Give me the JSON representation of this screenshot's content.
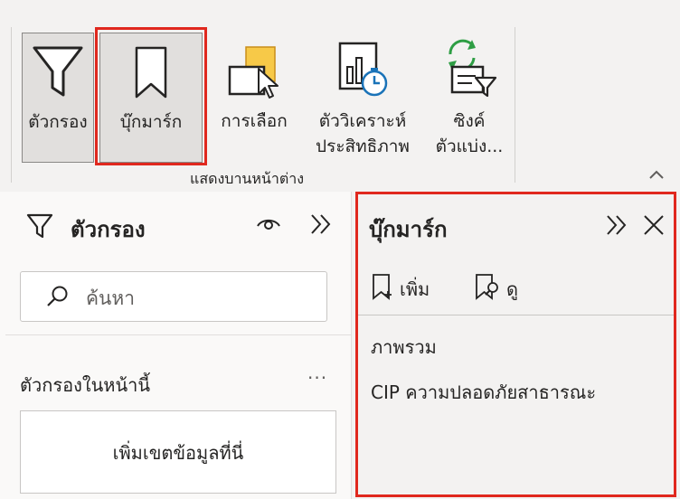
{
  "ribbon": {
    "buttons": {
      "filter": "ตัวกรอง",
      "bookmark": "บุ๊กมาร์ก",
      "selection": "การเลือก",
      "perf_line1": "ตัววิเคราะห์",
      "perf_line2": "ประสิทธิภาพ",
      "sync_line1": "ซิงค์",
      "sync_line2": "ตัวแบ่ง..."
    },
    "group_label": "แสดงบานหน้าต่าง"
  },
  "filters_pane": {
    "title": "ตัวกรอง",
    "search_placeholder": "ค้นหา",
    "section_title": "ตัวกรองในหน้านี้",
    "more": "···",
    "dropzone": "เพิ่มเขตข้อมูลที่นี่"
  },
  "bookmarks_pane": {
    "title": "บุ๊กมาร์ก",
    "add_label": "เพิ่ม",
    "view_label": "ดู",
    "items": [
      "ภาพรวม",
      "CIP ความปลอดภัยสาธารณะ"
    ]
  },
  "colors": {
    "highlight": "#e0281e",
    "background": "#f3f2f1",
    "accent_blue": "#1a73b8",
    "accent_green": "#2e9e44",
    "accent_yellow": "#f7c948"
  },
  "icons": [
    "filter-icon",
    "bookmark-icon",
    "selection-icon",
    "performance-analyzer-icon",
    "sync-slicers-icon",
    "eye-icon",
    "expand-icon",
    "close-icon",
    "search-icon",
    "add-bookmark-icon",
    "view-bookmark-icon",
    "chevron-up-icon"
  ]
}
